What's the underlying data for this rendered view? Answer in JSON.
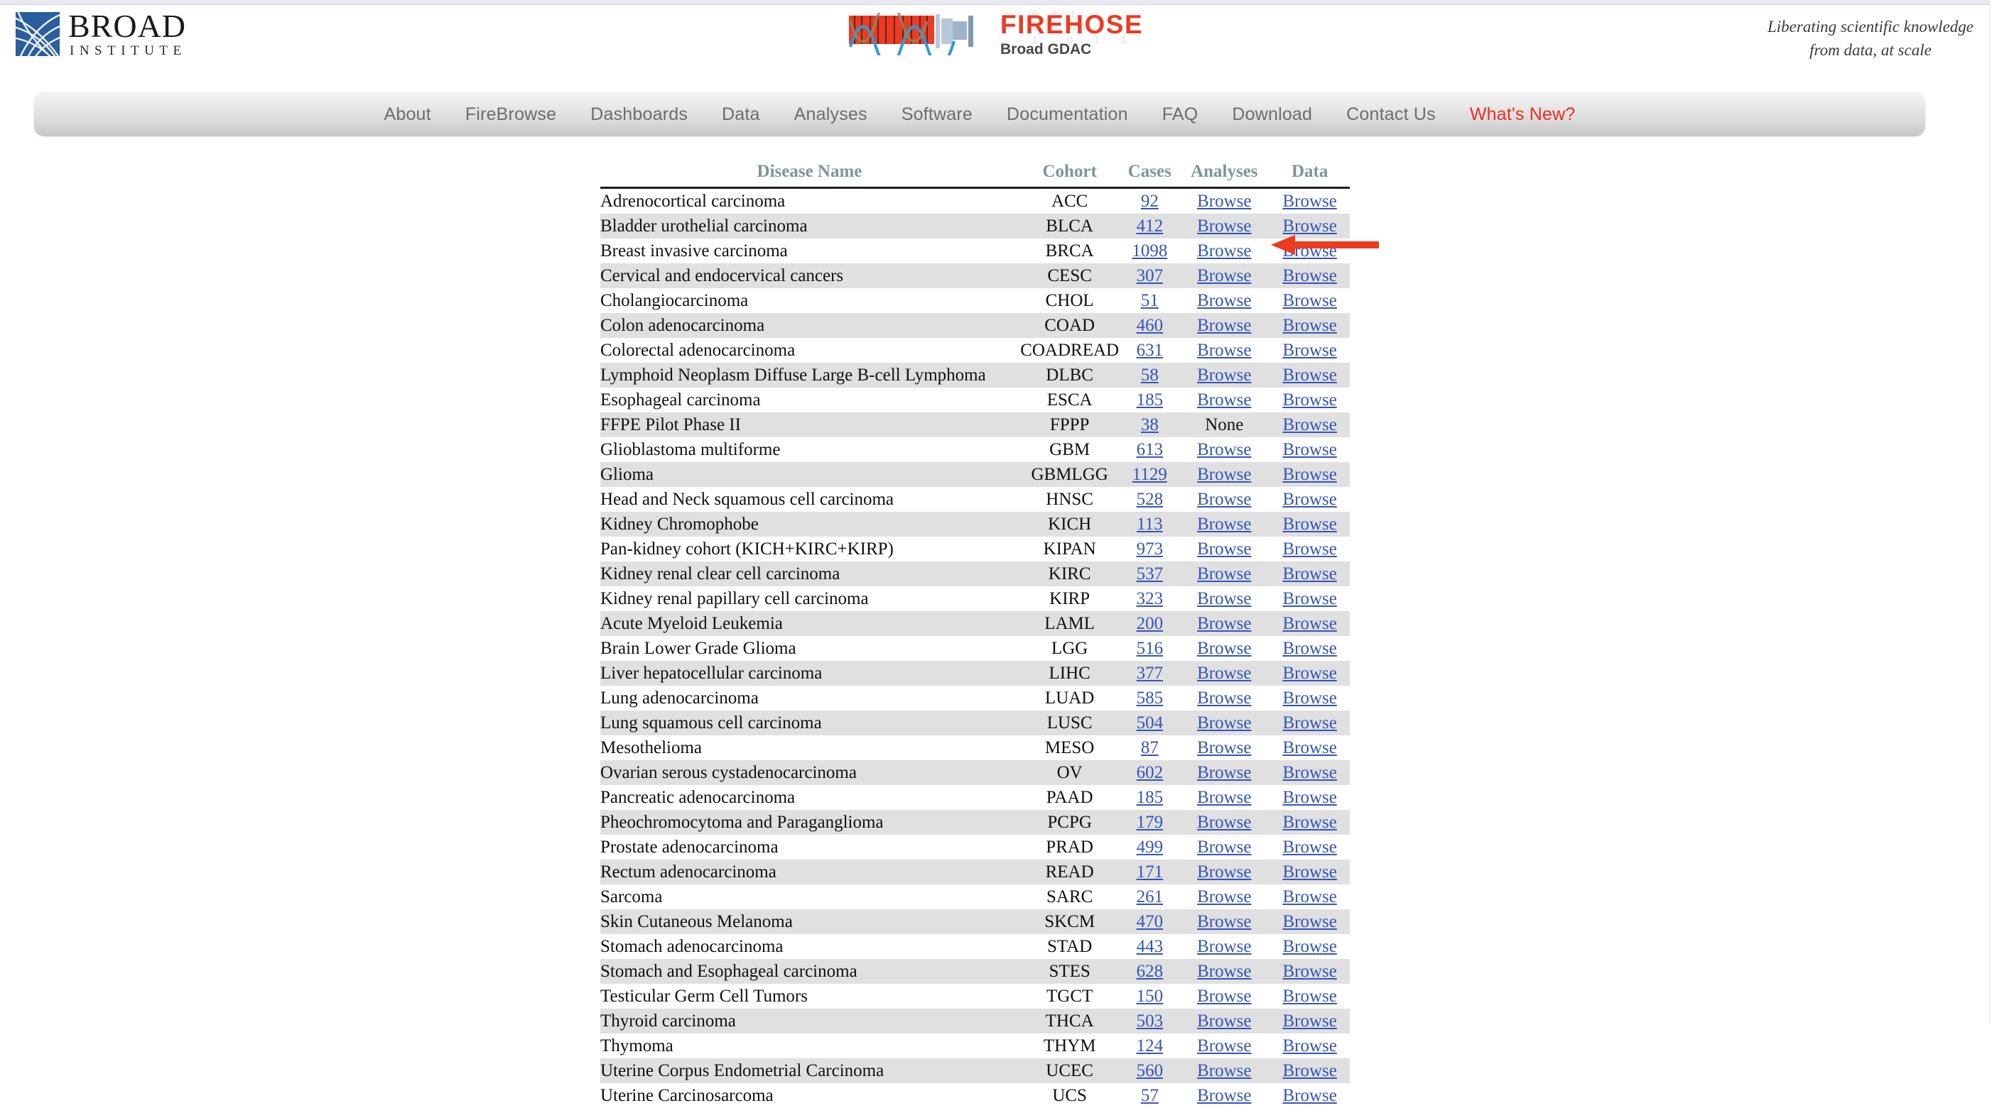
{
  "site": {
    "broad_logo_main": "BROAD",
    "broad_logo_sub": "INSTITUTE",
    "firehose_title": "FIREHOSE",
    "firehose_subtitle": "Broad GDAC",
    "firehose_binary": "0 1 1\n1 0 01\n1   0  1  1",
    "tagline_line1": "Liberating scientific knowledge",
    "tagline_line2": "from data, at scale",
    "accent_red": "#ee2c1e",
    "link_blue": "#3355bb",
    "header_teal": "#7d9698"
  },
  "nav": {
    "items": [
      {
        "label": "About",
        "accent": false
      },
      {
        "label": "FireBrowse",
        "accent": false
      },
      {
        "label": "Dashboards",
        "accent": false
      },
      {
        "label": "Data",
        "accent": false
      },
      {
        "label": "Analyses",
        "accent": false
      },
      {
        "label": "Software",
        "accent": false
      },
      {
        "label": "Documentation",
        "accent": false
      },
      {
        "label": "FAQ",
        "accent": false
      },
      {
        "label": "Download",
        "accent": false
      },
      {
        "label": "Contact Us",
        "accent": false
      },
      {
        "label": "What's New?",
        "accent": true
      }
    ]
  },
  "table": {
    "columns": [
      "Disease Name",
      "Cohort",
      "Cases",
      "Analyses",
      "Data"
    ],
    "browse_label": "Browse",
    "none_label": "None",
    "rows": [
      {
        "disease": "Adrenocortical carcinoma",
        "cohort": "ACC",
        "cases": "92",
        "analyses": "Browse",
        "data": "Browse"
      },
      {
        "disease": "Bladder urothelial carcinoma",
        "cohort": "BLCA",
        "cases": "412",
        "analyses": "Browse",
        "data": "Browse"
      },
      {
        "disease": "Breast invasive carcinoma",
        "cohort": "BRCA",
        "cases": "1098",
        "analyses": "Browse",
        "data": "Browse"
      },
      {
        "disease": "Cervical and endocervical cancers",
        "cohort": "CESC",
        "cases": "307",
        "analyses": "Browse",
        "data": "Browse"
      },
      {
        "disease": "Cholangiocarcinoma",
        "cohort": "CHOL",
        "cases": "51",
        "analyses": "Browse",
        "data": "Browse"
      },
      {
        "disease": "Colon adenocarcinoma",
        "cohort": "COAD",
        "cases": "460",
        "analyses": "Browse",
        "data": "Browse"
      },
      {
        "disease": "Colorectal adenocarcinoma",
        "cohort": "COADREAD",
        "cases": "631",
        "analyses": "Browse",
        "data": "Browse"
      },
      {
        "disease": "Lymphoid Neoplasm Diffuse Large B-cell Lymphoma",
        "cohort": "DLBC",
        "cases": "58",
        "analyses": "Browse",
        "data": "Browse"
      },
      {
        "disease": "Esophageal carcinoma",
        "cohort": "ESCA",
        "cases": "185",
        "analyses": "Browse",
        "data": "Browse"
      },
      {
        "disease": "FFPE Pilot Phase II",
        "cohort": "FPPP",
        "cases": "38",
        "analyses": "None",
        "data": "Browse"
      },
      {
        "disease": "Glioblastoma multiforme",
        "cohort": "GBM",
        "cases": "613",
        "analyses": "Browse",
        "data": "Browse"
      },
      {
        "disease": "Glioma",
        "cohort": "GBMLGG",
        "cases": "1129",
        "analyses": "Browse",
        "data": "Browse"
      },
      {
        "disease": "Head and Neck squamous cell carcinoma",
        "cohort": "HNSC",
        "cases": "528",
        "analyses": "Browse",
        "data": "Browse"
      },
      {
        "disease": "Kidney Chromophobe",
        "cohort": "KICH",
        "cases": "113",
        "analyses": "Browse",
        "data": "Browse"
      },
      {
        "disease": "Pan-kidney cohort (KICH+KIRC+KIRP)",
        "cohort": "KIPAN",
        "cases": "973",
        "analyses": "Browse",
        "data": "Browse"
      },
      {
        "disease": "Kidney renal clear cell carcinoma",
        "cohort": "KIRC",
        "cases": "537",
        "analyses": "Browse",
        "data": "Browse"
      },
      {
        "disease": "Kidney renal papillary cell carcinoma",
        "cohort": "KIRP",
        "cases": "323",
        "analyses": "Browse",
        "data": "Browse"
      },
      {
        "disease": "Acute Myeloid Leukemia",
        "cohort": "LAML",
        "cases": "200",
        "analyses": "Browse",
        "data": "Browse"
      },
      {
        "disease": "Brain Lower Grade Glioma",
        "cohort": "LGG",
        "cases": "516",
        "analyses": "Browse",
        "data": "Browse"
      },
      {
        "disease": "Liver hepatocellular carcinoma",
        "cohort": "LIHC",
        "cases": "377",
        "analyses": "Browse",
        "data": "Browse"
      },
      {
        "disease": "Lung adenocarcinoma",
        "cohort": "LUAD",
        "cases": "585",
        "analyses": "Browse",
        "data": "Browse"
      },
      {
        "disease": "Lung squamous cell carcinoma",
        "cohort": "LUSC",
        "cases": "504",
        "analyses": "Browse",
        "data": "Browse"
      },
      {
        "disease": "Mesothelioma",
        "cohort": "MESO",
        "cases": "87",
        "analyses": "Browse",
        "data": "Browse"
      },
      {
        "disease": "Ovarian serous cystadenocarcinoma",
        "cohort": "OV",
        "cases": "602",
        "analyses": "Browse",
        "data": "Browse"
      },
      {
        "disease": "Pancreatic adenocarcinoma",
        "cohort": "PAAD",
        "cases": "185",
        "analyses": "Browse",
        "data": "Browse"
      },
      {
        "disease": "Pheochromocytoma and Paraganglioma",
        "cohort": "PCPG",
        "cases": "179",
        "analyses": "Browse",
        "data": "Browse"
      },
      {
        "disease": "Prostate adenocarcinoma",
        "cohort": "PRAD",
        "cases": "499",
        "analyses": "Browse",
        "data": "Browse"
      },
      {
        "disease": "Rectum adenocarcinoma",
        "cohort": "READ",
        "cases": "171",
        "analyses": "Browse",
        "data": "Browse"
      },
      {
        "disease": "Sarcoma",
        "cohort": "SARC",
        "cases": "261",
        "analyses": "Browse",
        "data": "Browse"
      },
      {
        "disease": "Skin Cutaneous Melanoma",
        "cohort": "SKCM",
        "cases": "470",
        "analyses": "Browse",
        "data": "Browse"
      },
      {
        "disease": "Stomach adenocarcinoma",
        "cohort": "STAD",
        "cases": "443",
        "analyses": "Browse",
        "data": "Browse"
      },
      {
        "disease": "Stomach and Esophageal carcinoma",
        "cohort": "STES",
        "cases": "628",
        "analyses": "Browse",
        "data": "Browse"
      },
      {
        "disease": "Testicular Germ Cell Tumors",
        "cohort": "TGCT",
        "cases": "150",
        "analyses": "Browse",
        "data": "Browse"
      },
      {
        "disease": "Thyroid carcinoma",
        "cohort": "THCA",
        "cases": "503",
        "analyses": "Browse",
        "data": "Browse"
      },
      {
        "disease": "Thymoma",
        "cohort": "THYM",
        "cases": "124",
        "analyses": "Browse",
        "data": "Browse"
      },
      {
        "disease": "Uterine Corpus Endometrial Carcinoma",
        "cohort": "UCEC",
        "cases": "560",
        "analyses": "Browse",
        "data": "Browse"
      },
      {
        "disease": "Uterine Carcinosarcoma",
        "cohort": "UCS",
        "cases": "57",
        "analyses": "Browse",
        "data": "Browse"
      }
    ]
  },
  "annotation": {
    "arrow_color": "#ee3a1e",
    "points_at_row": "Breast invasive carcinoma",
    "points_at_column": "Data"
  }
}
